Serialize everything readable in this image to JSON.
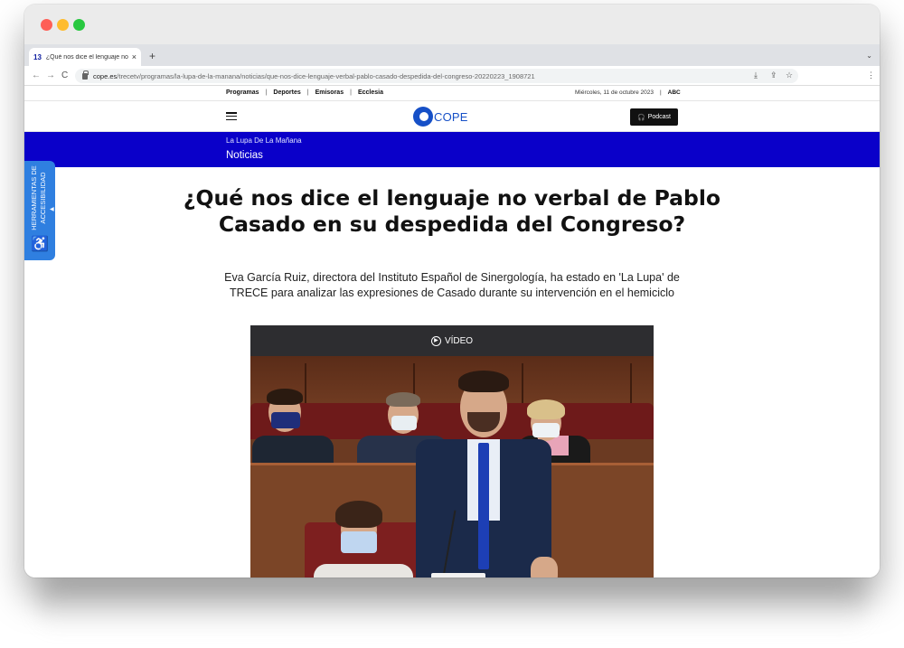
{
  "browser": {
    "tab_favicon": "13",
    "tab_title": "¿Qué nos dice el lenguaje no verbal",
    "tab_close": "×",
    "new_tab": "+",
    "tab_menu": "⌄",
    "url_domain": "cope.es",
    "url_path": "/trecetv/programas/la-lupa-de-la-manana/noticias/que-nos-dice-lenguaje-verbal-pablo-casado-despedida-del-congreso-20220223_1908721",
    "nav_back": "←",
    "nav_forward": "→",
    "nav_reload": "C"
  },
  "topnav": {
    "links": [
      "Programas",
      "Deportes",
      "Emisoras",
      "Ecclesia"
    ],
    "separator": "|",
    "date": "Miércoles, 11 de octubre 2023",
    "partner": "ABC"
  },
  "header": {
    "logo_text": "COPE",
    "podcast_label": "Podcast"
  },
  "section": {
    "parent": "La Lupa De La Mañana",
    "title": "Noticias"
  },
  "accessibility": {
    "label_line1": "HERRAMIENTAS DE",
    "label_line2": "ACCESIBILIDAD"
  },
  "article": {
    "headline": "¿Qué nos dice el lenguaje no verbal de Pablo Casado en su despedida del Congreso?",
    "subhead": "Eva García Ruiz, directora del Instituto Español de Sinergología, ha estado en 'La Lupa' de TRECE para analizar las expresiones de Casado durante su intervención en el hemiciclo",
    "video_label": "VÍDEO"
  },
  "colors": {
    "section_band": "#0a00c9",
    "cope_blue": "#1650c7",
    "a11y_blue": "#2f7fe0"
  }
}
